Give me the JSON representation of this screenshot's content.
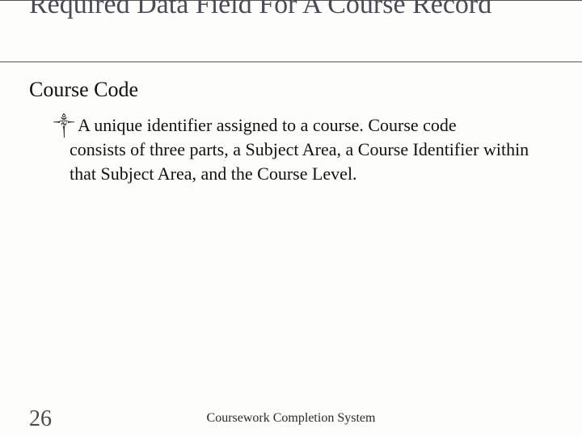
{
  "title": "Required Data Field For A Course Record",
  "subhead": "Course Code",
  "bullet": {
    "glyph": "༒",
    "line1": "A unique identifier assigned to a course.  Course code",
    "rest": "consists of three parts, a Subject Area, a Course Identifier within that Subject Area, and the Course Level."
  },
  "page_number": "26",
  "footer": "Coursework Completion System"
}
